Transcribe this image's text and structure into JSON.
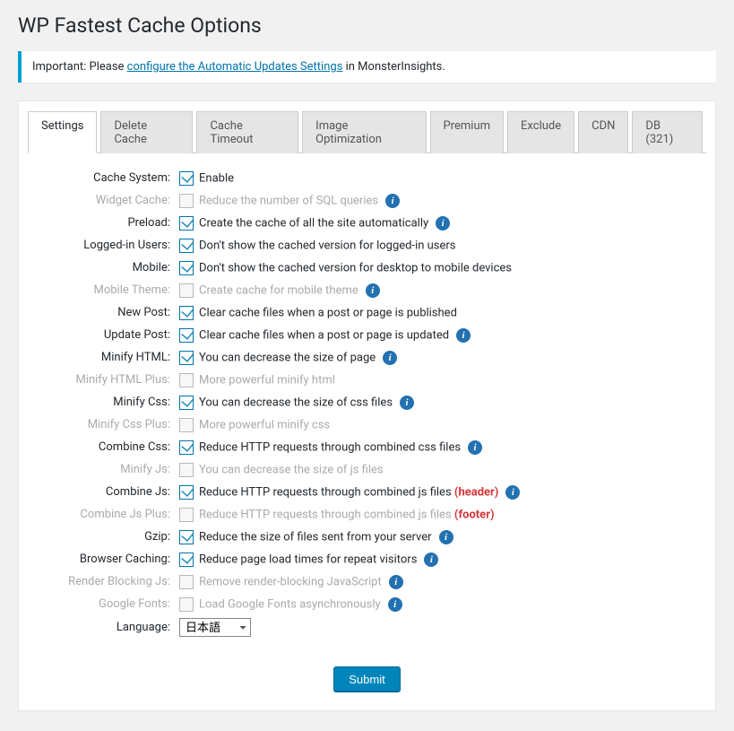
{
  "page_title": "WP Fastest Cache Options",
  "notice": {
    "prefix": "Important: Please ",
    "link_text": "configure the Automatic Updates Settings",
    "suffix": " in MonsterInsights."
  },
  "tabs": [
    {
      "label": "Settings",
      "active": true
    },
    {
      "label": "Delete Cache",
      "active": false
    },
    {
      "label": "Cache Timeout",
      "active": false
    },
    {
      "label": "Image Optimization",
      "active": false
    },
    {
      "label": "Premium",
      "active": false
    },
    {
      "label": "Exclude",
      "active": false
    },
    {
      "label": "CDN",
      "active": false
    },
    {
      "label": "DB (321)",
      "active": false
    }
  ],
  "options": [
    {
      "key": "cache_system",
      "label": "Cache System:",
      "desc": "Enable",
      "checked": true,
      "disabled": false,
      "info": false,
      "note": ""
    },
    {
      "key": "widget_cache",
      "label": "Widget Cache:",
      "desc": "Reduce the number of SQL queries",
      "checked": false,
      "disabled": true,
      "info": true,
      "note": ""
    },
    {
      "key": "preload",
      "label": "Preload:",
      "desc": "Create the cache of all the site automatically",
      "checked": true,
      "disabled": false,
      "info": true,
      "note": ""
    },
    {
      "key": "logged_in",
      "label": "Logged-in Users:",
      "desc": "Don't show the cached version for logged-in users",
      "checked": true,
      "disabled": false,
      "info": false,
      "note": ""
    },
    {
      "key": "mobile",
      "label": "Mobile:",
      "desc": "Don't show the cached version for desktop to mobile devices",
      "checked": true,
      "disabled": false,
      "info": false,
      "note": ""
    },
    {
      "key": "mobile_theme",
      "label": "Mobile Theme:",
      "desc": "Create cache for mobile theme",
      "checked": false,
      "disabled": true,
      "info": true,
      "note": ""
    },
    {
      "key": "new_post",
      "label": "New Post:",
      "desc": "Clear cache files when a post or page is published",
      "checked": true,
      "disabled": false,
      "info": false,
      "note": ""
    },
    {
      "key": "update_post",
      "label": "Update Post:",
      "desc": "Clear cache files when a post or page is updated",
      "checked": true,
      "disabled": false,
      "info": true,
      "note": ""
    },
    {
      "key": "minify_html",
      "label": "Minify HTML:",
      "desc": "You can decrease the size of page",
      "checked": true,
      "disabled": false,
      "info": true,
      "note": ""
    },
    {
      "key": "minify_html_plus",
      "label": "Minify HTML Plus:",
      "desc": "More powerful minify html",
      "checked": false,
      "disabled": true,
      "info": false,
      "note": ""
    },
    {
      "key": "minify_css",
      "label": "Minify Css:",
      "desc": "You can decrease the size of css files",
      "checked": true,
      "disabled": false,
      "info": true,
      "note": ""
    },
    {
      "key": "minify_css_plus",
      "label": "Minify Css Plus:",
      "desc": "More powerful minify css",
      "checked": false,
      "disabled": true,
      "info": false,
      "note": ""
    },
    {
      "key": "combine_css",
      "label": "Combine Css:",
      "desc": "Reduce HTTP requests through combined css files",
      "checked": true,
      "disabled": false,
      "info": true,
      "note": ""
    },
    {
      "key": "minify_js",
      "label": "Minify Js:",
      "desc": "You can decrease the size of js files",
      "checked": false,
      "disabled": true,
      "info": false,
      "note": ""
    },
    {
      "key": "combine_js",
      "label": "Combine Js:",
      "desc": "Reduce HTTP requests through combined js files",
      "checked": true,
      "disabled": false,
      "info": true,
      "note": "(header)"
    },
    {
      "key": "combine_js_plus",
      "label": "Combine Js Plus:",
      "desc": "Reduce HTTP requests through combined js files",
      "checked": false,
      "disabled": true,
      "info": false,
      "note": "(footer)"
    },
    {
      "key": "gzip",
      "label": "Gzip:",
      "desc": "Reduce the size of files sent from your server",
      "checked": true,
      "disabled": false,
      "info": true,
      "note": ""
    },
    {
      "key": "browser_caching",
      "label": "Browser Caching:",
      "desc": "Reduce page load times for repeat visitors",
      "checked": true,
      "disabled": false,
      "info": true,
      "note": ""
    },
    {
      "key": "render_blocking",
      "label": "Render Blocking Js:",
      "desc": "Remove render-blocking JavaScript",
      "checked": false,
      "disabled": true,
      "info": true,
      "note": ""
    },
    {
      "key": "google_fonts",
      "label": "Google Fonts:",
      "desc": "Load Google Fonts asynchronously",
      "checked": false,
      "disabled": true,
      "info": true,
      "note": ""
    }
  ],
  "language": {
    "label": "Language:",
    "selected": "日本語"
  },
  "submit_label": "Submit"
}
